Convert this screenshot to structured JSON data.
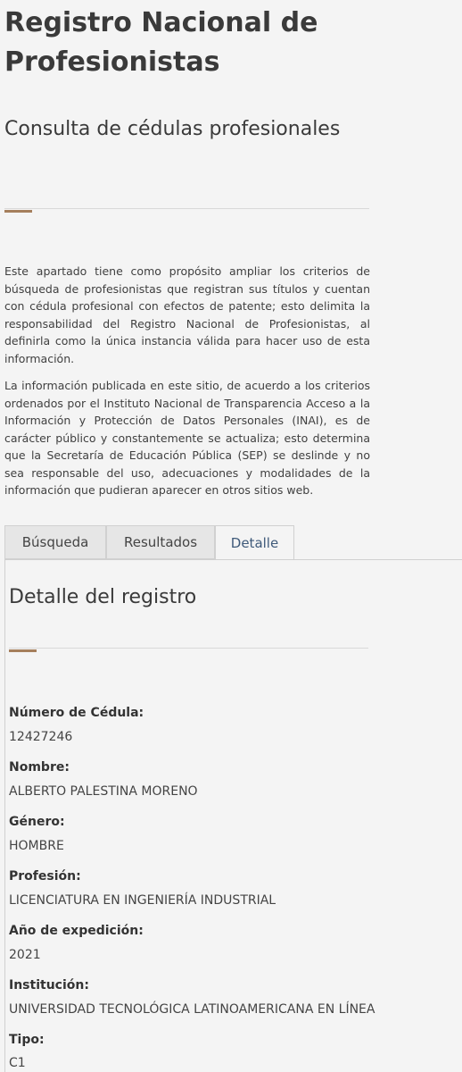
{
  "header": {
    "title": "Registro Nacional de Profesionistas",
    "subtitle": "Consulta de cédulas profesionales"
  },
  "intro": {
    "paragraph1": "Este apartado tiene como propósito ampliar los criterios de búsqueda de profesionistas que registran sus títulos y cuentan con cédula profesional con efectos de patente; esto delimita la responsabilidad del Registro Nacional de Profesionistas, al definirla como la única instancia válida para hacer uso de esta información.",
    "paragraph2": "La información publicada en este sitio, de acuerdo a los criterios ordenados por el Instituto Nacional de Transparencia  Acceso a la Información y Protección de Datos Personales (INAI), es de carácter público y constantemente se actualiza; esto determina que la Secretaría de Educación Pública (SEP) se deslinde y no sea responsable del uso, adecuaciones y modalidades de la información que pudieran aparecer en otros sitios web."
  },
  "tabs": [
    {
      "label": "Búsqueda"
    },
    {
      "label": "Resultados"
    },
    {
      "label": "Detalle"
    }
  ],
  "detail": {
    "heading": "Detalle del registro",
    "fields": [
      {
        "label": "Número de Cédula:",
        "value": "12427246"
      },
      {
        "label": "Nombre:",
        "value": "ALBERTO PALESTINA MORENO"
      },
      {
        "label": "Género:",
        "value": "HOMBRE"
      },
      {
        "label": "Profesión:",
        "value": "LICENCIATURA EN INGENIERÍA INDUSTRIAL"
      },
      {
        "label": "Año de expedición:",
        "value": "2021"
      },
      {
        "label": "Institución:",
        "value": "UNIVERSIDAD TECNOLÓGICA LATINOAMERICANA EN LÍNEA"
      },
      {
        "label": "Tipo:",
        "value": "C1"
      }
    ]
  },
  "colors": {
    "accent": "#a57f5c",
    "background": "#f4f4f4",
    "active_tab_text": "#3f5a7a"
  }
}
